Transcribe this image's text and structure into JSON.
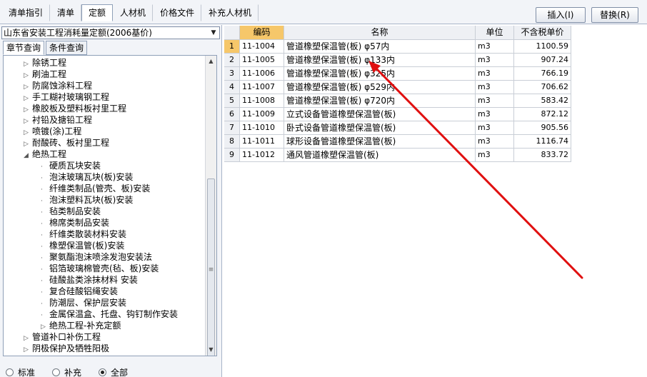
{
  "tabs": [
    {
      "label": "清单指引"
    },
    {
      "label": "清单"
    },
    {
      "label": "定额"
    },
    {
      "label": "人材机"
    },
    {
      "label": "价格文件"
    },
    {
      "label": "补充人材机"
    }
  ],
  "buttons": {
    "insert": "插入(I)",
    "replace": "替换(R)"
  },
  "quota_library": "山东省安装工程消耗量定额(2006基价)",
  "subtabs": [
    {
      "label": "章节查询"
    },
    {
      "label": "条件查询"
    }
  ],
  "tree": [
    {
      "label": "除锈工程",
      "level": 1,
      "expanded": false
    },
    {
      "label": "刷油工程",
      "level": 1,
      "expanded": false
    },
    {
      "label": "防腐蚀涂料工程",
      "level": 1,
      "expanded": false
    },
    {
      "label": "手工糊衬玻璃钢工程",
      "level": 1,
      "expanded": false
    },
    {
      "label": "橡胶板及塑料板衬里工程",
      "level": 1,
      "expanded": false
    },
    {
      "label": "衬铅及搪铅工程",
      "level": 1,
      "expanded": false
    },
    {
      "label": "喷镀(涂)工程",
      "level": 1,
      "expanded": false
    },
    {
      "label": "耐酸砖、板衬里工程",
      "level": 1,
      "expanded": false
    },
    {
      "label": "绝热工程",
      "level": 1,
      "expanded": true
    },
    {
      "label": "硬质瓦块安装",
      "level": 2
    },
    {
      "label": "泡沫玻璃瓦块(板)安装",
      "level": 2
    },
    {
      "label": "纤维类制品(管壳、板)安装",
      "level": 2
    },
    {
      "label": "泡沫塑料瓦块(板)安装",
      "level": 2
    },
    {
      "label": "毡类制品安装",
      "level": 2
    },
    {
      "label": "棉席类制品安装",
      "level": 2
    },
    {
      "label": "纤维类散装材料安装",
      "level": 2
    },
    {
      "label": "橡塑保温管(板)安装",
      "level": 2
    },
    {
      "label": "聚氨酯泡沫喷涂发泡安装法",
      "level": 2
    },
    {
      "label": "铝箔玻璃棉管壳(毡、板)安装",
      "level": 2
    },
    {
      "label": "硅酸盐类涂抹材料 安装",
      "level": 2
    },
    {
      "label": "复合硅酸铝绳安装",
      "level": 2
    },
    {
      "label": "防潮层、保护层安装",
      "level": 2
    },
    {
      "label": "金属保温盒、托盘、钩钉制作安装",
      "level": 2
    },
    {
      "label": "绝热工程-补充定额",
      "level": 2,
      "expandable": true
    },
    {
      "label": "管道补口补伤工程",
      "level": 1,
      "expanded": false
    },
    {
      "label": "阴极保护及牺牲阳极",
      "level": 1,
      "expanded": false
    }
  ],
  "radios": [
    {
      "label": "标准",
      "checked": false
    },
    {
      "label": "补充",
      "checked": false
    },
    {
      "label": "全部",
      "checked": true
    }
  ],
  "grid": {
    "headers": {
      "code": "编码",
      "name": "名称",
      "unit": "单位",
      "price": "不含税单价"
    },
    "rows": [
      {
        "idx": "1",
        "code": "11-1004",
        "name": "管道橡塑保温管(板) φ57内",
        "unit": "m3",
        "price": "1100.59"
      },
      {
        "idx": "2",
        "code": "11-1005",
        "name": "管道橡塑保温管(板) φ133内",
        "unit": "m3",
        "price": "907.24"
      },
      {
        "idx": "3",
        "code": "11-1006",
        "name": "管道橡塑保温管(板) φ325内",
        "unit": "m3",
        "price": "766.19"
      },
      {
        "idx": "4",
        "code": "11-1007",
        "name": "管道橡塑保温管(板) φ529内",
        "unit": "m3",
        "price": "706.62"
      },
      {
        "idx": "5",
        "code": "11-1008",
        "name": "管道橡塑保温管(板) φ720内",
        "unit": "m3",
        "price": "583.42"
      },
      {
        "idx": "6",
        "code": "11-1009",
        "name": "立式设备管道橡塑保温管(板)",
        "unit": "m3",
        "price": "872.12"
      },
      {
        "idx": "7",
        "code": "11-1010",
        "name": "卧式设备管道橡塑保温管(板)",
        "unit": "m3",
        "price": "905.56"
      },
      {
        "idx": "8",
        "code": "11-1011",
        "name": "球形设备管道橡塑保温管(板)",
        "unit": "m3",
        "price": "1116.74"
      },
      {
        "idx": "9",
        "code": "11-1012",
        "name": "通风管道橡塑保温管(板)",
        "unit": "m3",
        "price": "833.72"
      }
    ]
  },
  "colors": {
    "annotation_arrow": "#e01010",
    "selected_header": "#f6c76a"
  }
}
